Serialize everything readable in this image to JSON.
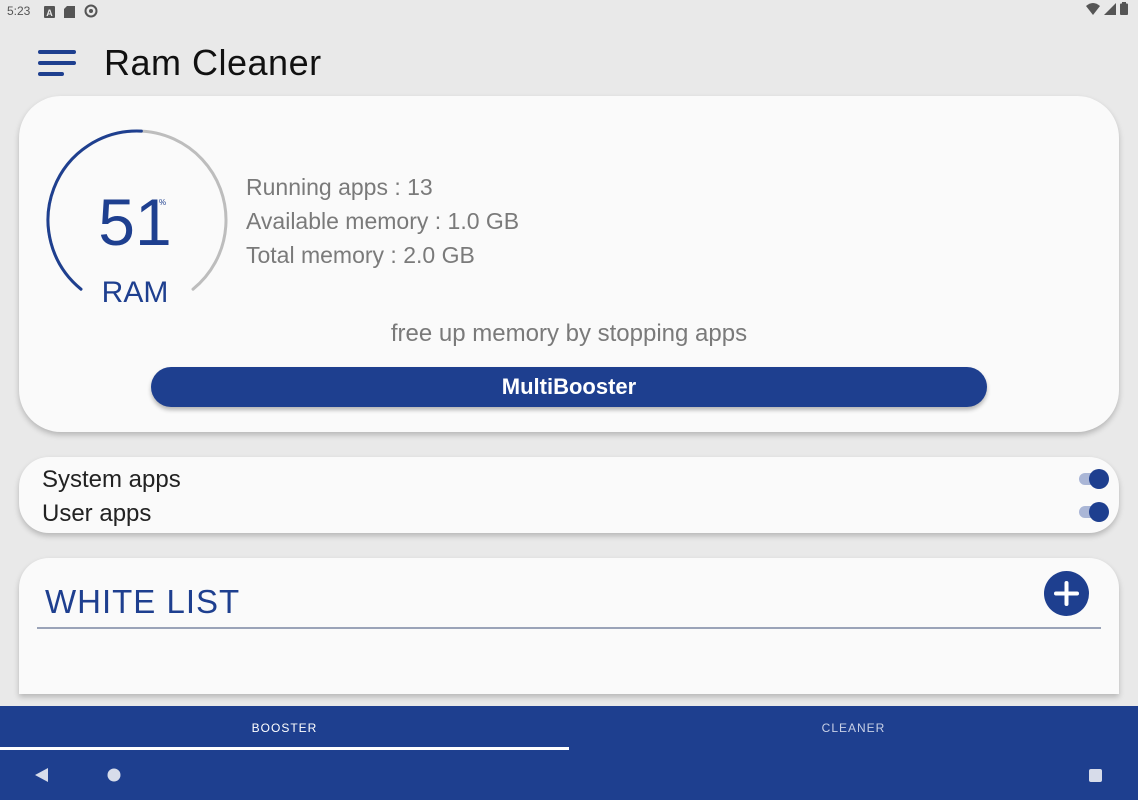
{
  "status_bar": {
    "time": "5:23",
    "left_icons": [
      "a-notification-icon",
      "sd-card-icon",
      "sync-icon"
    ],
    "right_icons": [
      "wifi-icon",
      "signal-icon",
      "battery-icon"
    ]
  },
  "app_bar": {
    "title": "Ram Cleaner",
    "menu_icon": "hamburger-menu-icon"
  },
  "ram": {
    "value": "51",
    "percent_sign": "%",
    "label": "RAM",
    "progress": 0.51
  },
  "stats": {
    "running_apps": "Running apps : 13",
    "available_memory": "Available memory : 1.0 GB",
    "total_memory": "Total memory : 2.0 GB"
  },
  "hint": "free up memory by stopping apps",
  "boost_button": "MultiBooster",
  "toggles": [
    {
      "label": "System apps",
      "on": true
    },
    {
      "label": "User apps",
      "on": true
    }
  ],
  "white_list": {
    "title": "WHITE LIST",
    "add_icon": "plus-icon"
  },
  "tabs": [
    {
      "label": "BOOSTER",
      "active": true
    },
    {
      "label": "CLEANER",
      "active": false
    }
  ],
  "colors": {
    "accent": "#1e3f8f",
    "background": "#e9e9e9",
    "card": "#fafafa",
    "muted_text": "#7a7a7a"
  }
}
